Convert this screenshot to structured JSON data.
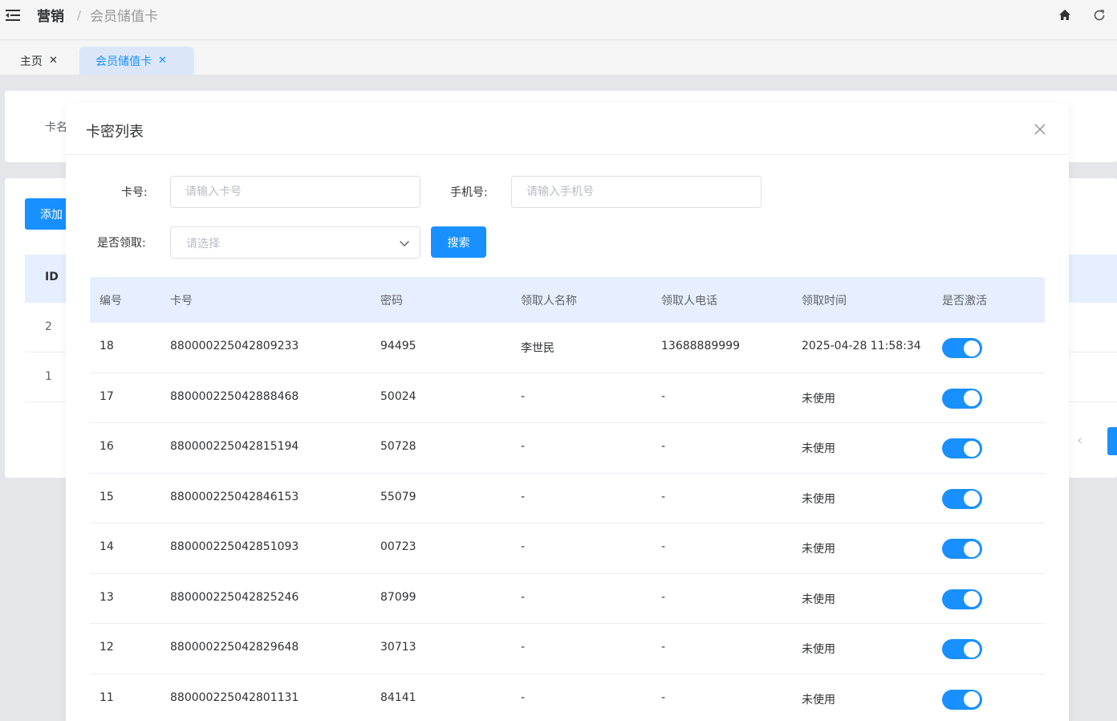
{
  "header": {
    "breadcrumb": [
      "营销",
      "会员储值卡"
    ],
    "breadcrumb_sep": "/"
  },
  "tabs": [
    {
      "label": "主页",
      "close": "✕"
    },
    {
      "label": "会员储值卡",
      "close": "✕"
    }
  ],
  "background": {
    "filter_label": "卡名",
    "add_button": "添加",
    "table_header_id": "ID",
    "rows": [
      "2",
      "1"
    ],
    "pager_prev": "‹"
  },
  "modal": {
    "title": "卡密列表",
    "filters": {
      "card_no_label": "卡号:",
      "card_no_placeholder": "请输入卡号",
      "phone_label": "手机号:",
      "phone_placeholder": "请输入手机号",
      "claimed_label": "是否领取:",
      "claimed_placeholder": "请选择",
      "search_button": "搜索"
    },
    "columns": [
      "编号",
      "卡号",
      "密码",
      "领取人名称",
      "领取人电话",
      "领取时间",
      "是否激活"
    ],
    "rows": [
      {
        "id": "18",
        "card": "880000225042809233",
        "pwd": "94495",
        "name": "李世民",
        "phone": "13688889999",
        "time": "2025-04-28 11:58:34",
        "active": true
      },
      {
        "id": "17",
        "card": "880000225042888468",
        "pwd": "50024",
        "name": "-",
        "phone": "-",
        "time": "未使用",
        "active": true
      },
      {
        "id": "16",
        "card": "880000225042815194",
        "pwd": "50728",
        "name": "-",
        "phone": "-",
        "time": "未使用",
        "active": true
      },
      {
        "id": "15",
        "card": "880000225042846153",
        "pwd": "55079",
        "name": "-",
        "phone": "-",
        "time": "未使用",
        "active": true
      },
      {
        "id": "14",
        "card": "880000225042851093",
        "pwd": "00723",
        "name": "-",
        "phone": "-",
        "time": "未使用",
        "active": true
      },
      {
        "id": "13",
        "card": "880000225042825246",
        "pwd": "87099",
        "name": "-",
        "phone": "-",
        "time": "未使用",
        "active": true
      },
      {
        "id": "12",
        "card": "880000225042829648",
        "pwd": "30713",
        "name": "-",
        "phone": "-",
        "time": "未使用",
        "active": true
      },
      {
        "id": "11",
        "card": "880000225042801131",
        "pwd": "84141",
        "name": "-",
        "phone": "-",
        "time": "未使用",
        "active": true
      }
    ]
  },
  "colors": {
    "primary": "#1890ff",
    "table_header_bg": "#e6efff",
    "tab_active_bg": "#dbe7f8"
  }
}
